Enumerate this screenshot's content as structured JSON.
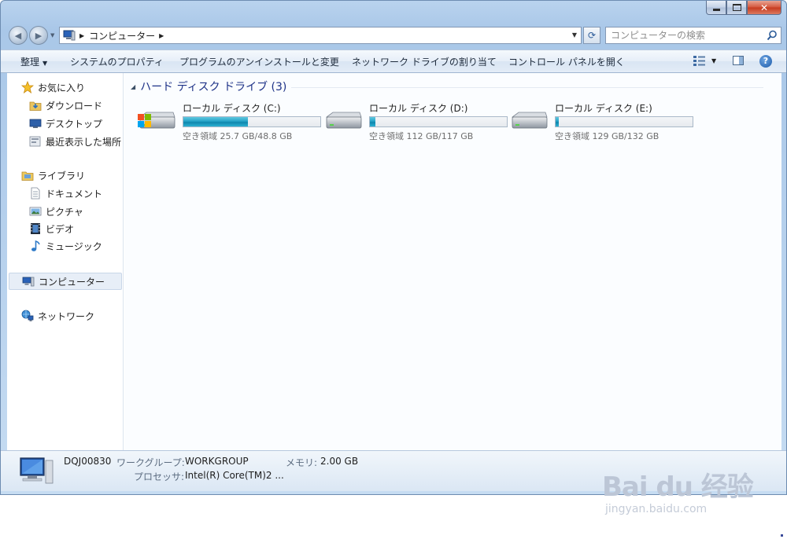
{
  "window": {
    "caption": {
      "minimize": "–",
      "close": "✕"
    }
  },
  "address": {
    "location": "コンピューター",
    "search_placeholder": "コンピューターの検索"
  },
  "commands": {
    "organize": "整理",
    "system_properties": "システムのプロパティ",
    "uninstall": "プログラムのアンインストールと変更",
    "map_drive": "ネットワーク ドライブの割り当て",
    "control_panel": "コントロール パネルを開く",
    "help": "?"
  },
  "sidebar": {
    "favorites": {
      "label": "お気に入り",
      "items": [
        {
          "label": "ダウンロード",
          "icon": "downloads-icon"
        },
        {
          "label": "デスクトップ",
          "icon": "desktop-icon"
        },
        {
          "label": "最近表示した場所",
          "icon": "recent-places-icon"
        }
      ]
    },
    "libraries": {
      "label": "ライブラリ",
      "items": [
        {
          "label": "ドキュメント",
          "icon": "documents-icon"
        },
        {
          "label": "ピクチャ",
          "icon": "pictures-icon"
        },
        {
          "label": "ビデオ",
          "icon": "videos-icon"
        },
        {
          "label": "ミュージック",
          "icon": "music-icon"
        }
      ]
    },
    "computer": {
      "label": "コンピューター"
    },
    "network": {
      "label": "ネットワーク"
    }
  },
  "main": {
    "group": {
      "title": "ハード ディスク ドライブ (3)"
    },
    "drives": [
      {
        "name": "ローカル ディスク (C:)",
        "free_text": "空き領域 25.7 GB/48.8 GB",
        "used_fraction": 0.473,
        "system": true
      },
      {
        "name": "ローカル ディスク (D:)",
        "free_text": "空き領域 112 GB/117 GB",
        "used_fraction": 0.043,
        "system": false
      },
      {
        "name": "ローカル ディスク (E:)",
        "free_text": "空き領域 129 GB/132 GB",
        "used_fraction": 0.023,
        "system": false
      }
    ]
  },
  "details": {
    "computer_name": "DQJ00830",
    "workgroup_label": "ワークグループ:",
    "workgroup_value": "WORKGROUP",
    "memory_label": "メモリ:",
    "memory_value": "2.00 GB",
    "processor_label": "プロセッサ:",
    "processor_value": "Intel(R) Core(TM)2 ..."
  },
  "watermark": {
    "logo": "Bai du 经验",
    "sub": "jingyan.baidu.com"
  },
  "colors": {
    "accent": "#1e3287",
    "bar_fill": "#25a3c7"
  }
}
